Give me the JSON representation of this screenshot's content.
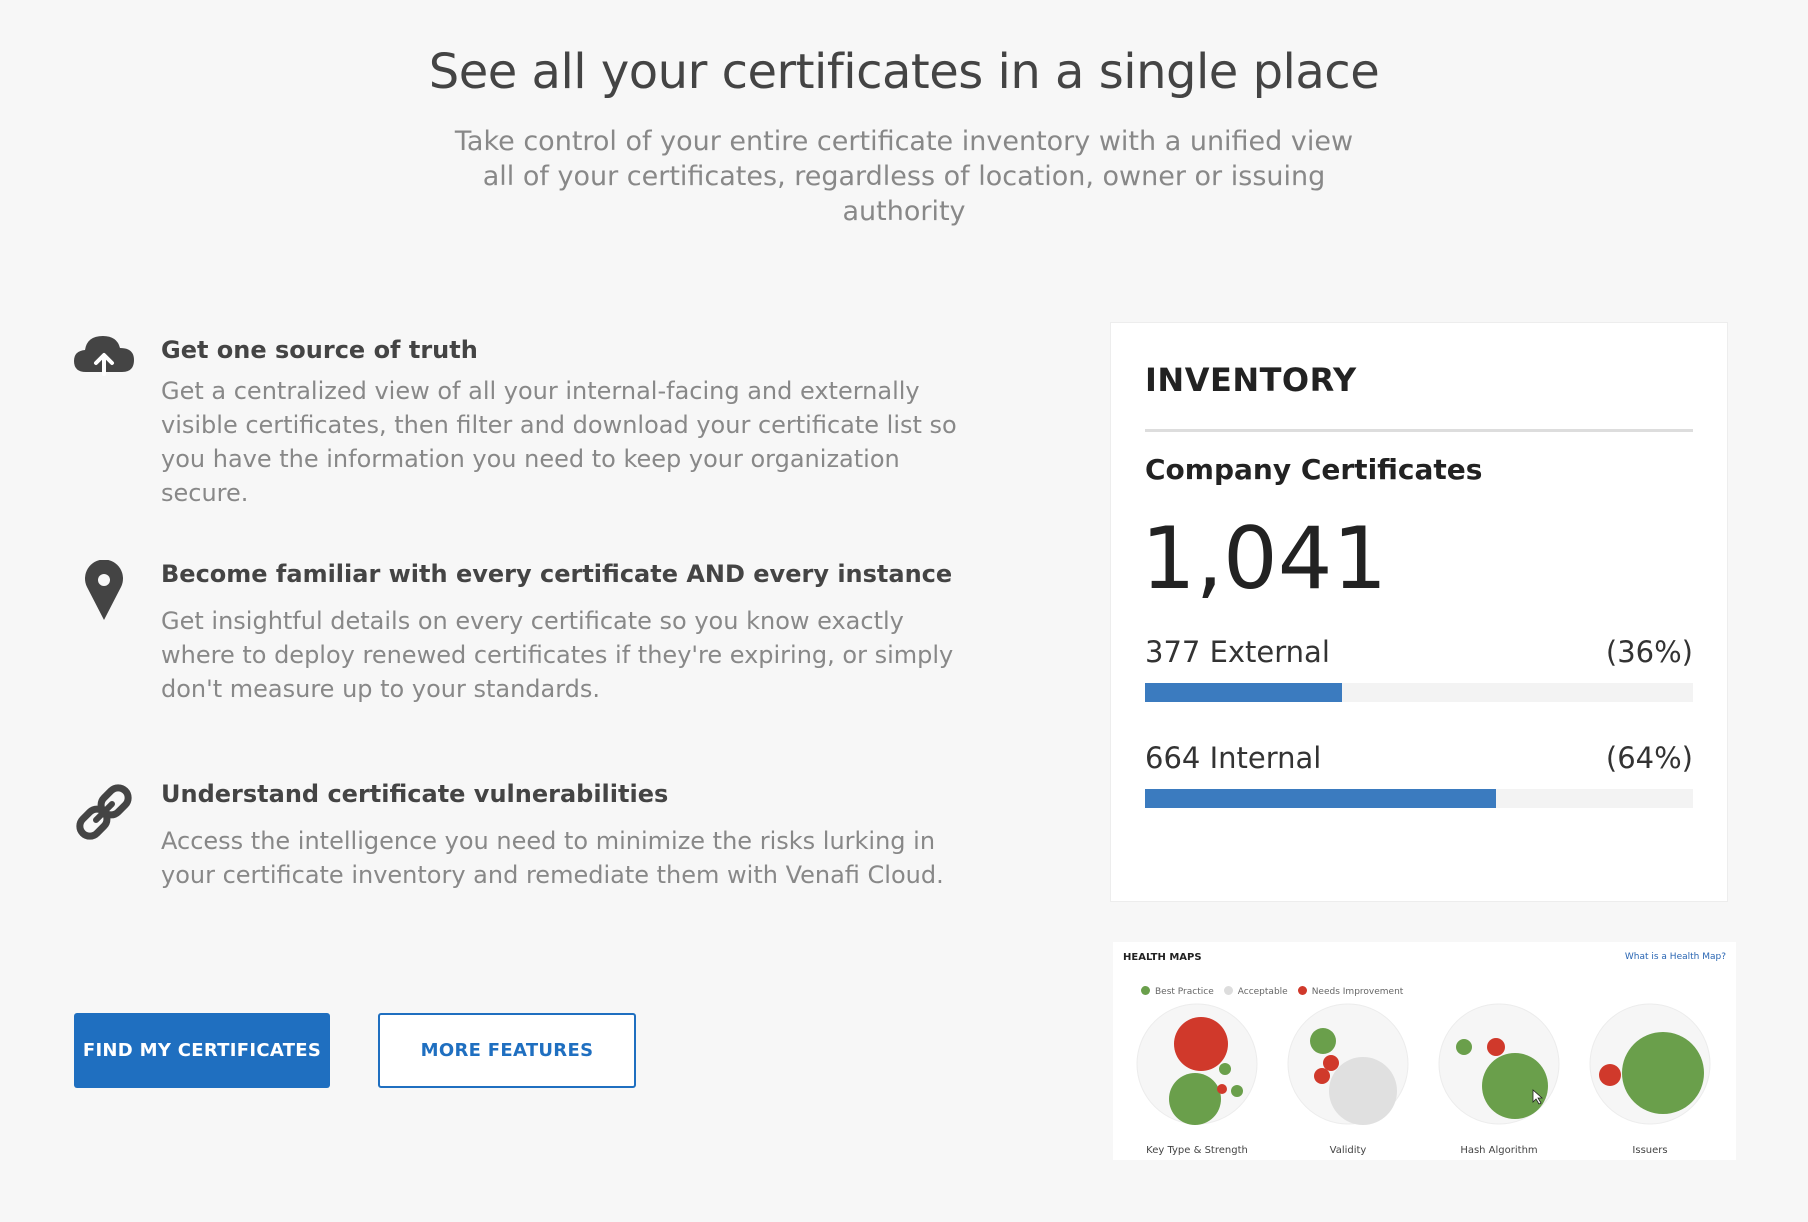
{
  "hero": {
    "title": "See all your certificates in a single place",
    "subtitle": "Take control of your entire certificate inventory with a unified view all of your certificates, regardless of location, owner or issuing authority"
  },
  "features": [
    {
      "icon": "cloud-upload-icon",
      "title": "Get one source of truth",
      "body": "Get a centralized view of all your internal-facing and externally visible certificates, then filter and download your certificate list so you have the information you need to keep your organization secure."
    },
    {
      "icon": "map-pin-icon",
      "title": "Become familiar with every certificate AND every instance",
      "body": "Get insightful details on every certificate so you know exactly where to deploy renewed certificates if they're expiring, or simply don't measure up to your standards."
    },
    {
      "icon": "link-icon",
      "title": "Understand certificate vulnerabilities",
      "body": "Access the intelligence you need to minimize the risks lurking in your certificate inventory and remediate them with Venafi Cloud."
    }
  ],
  "buttons": {
    "primary": "FIND MY CERTIFICATES",
    "secondary": "MORE FEATURES"
  },
  "inventory": {
    "title": "INVENTORY",
    "subtitle": "Company Certificates",
    "total": "1,041",
    "rows": [
      {
        "label": "377 External",
        "percent_label": "(36%)",
        "fraction": 0.36
      },
      {
        "label": "664 Internal",
        "percent_label": "(64%)",
        "fraction": 0.64
      }
    ],
    "bar_color": "#3b7bbf"
  },
  "health_maps": {
    "title": "HEALTH MAPS",
    "link": "What is a Health Map?",
    "legend": [
      {
        "label": "Best Practice",
        "color": "#6a9f4b"
      },
      {
        "label": "Acceptable",
        "color": "#dddddd"
      },
      {
        "label": "Needs Improvement",
        "color": "#d0392b"
      }
    ],
    "maps": [
      {
        "label": "Key Type & Strength"
      },
      {
        "label": "Validity"
      },
      {
        "label": "Hash Algorithm"
      },
      {
        "label": "Issuers"
      }
    ]
  },
  "colors": {
    "brand_blue": "#1f6fc0",
    "background": "#f7f7f7"
  }
}
